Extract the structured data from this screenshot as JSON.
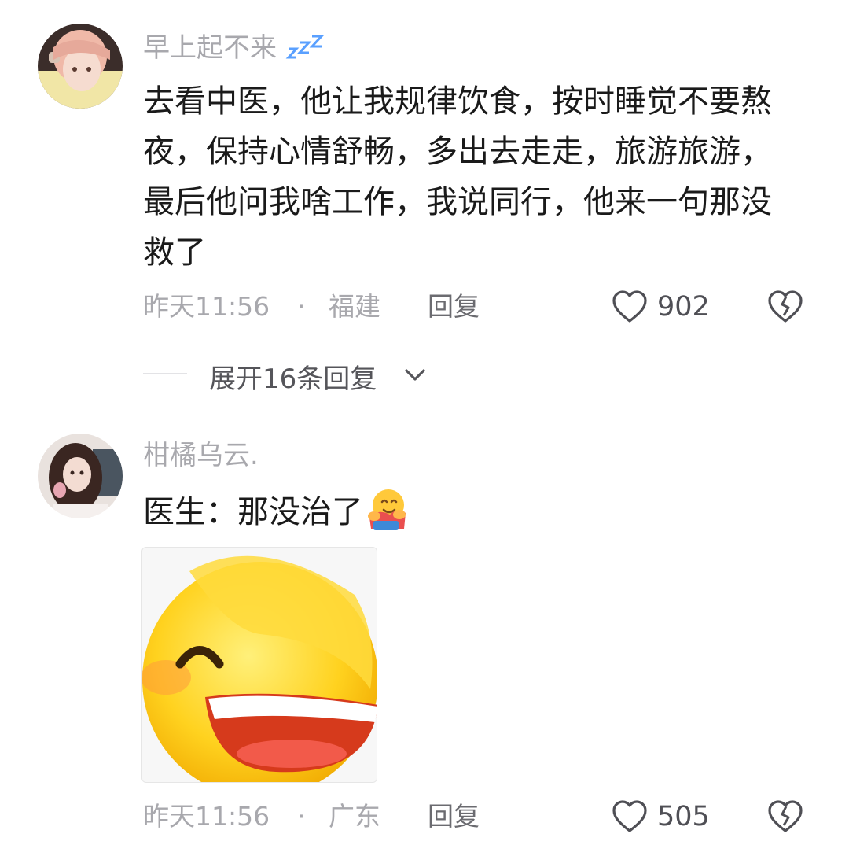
{
  "comments": [
    {
      "username": "早上起不来",
      "username_emoji": "zzz-icon",
      "text": "去看中医，他让我规律饮食，按时睡觉不要熬夜，保持心情舒畅，多出去走走，旅游旅游，最后他问我啥工作，我说同行，他来一句那没救了",
      "time": "昨天11:56",
      "separator": "·",
      "location": "福建",
      "reply_label": "回复",
      "likes": "902"
    },
    {
      "username": "柑橘乌云.",
      "text": "医生：那没治了",
      "text_emoji": "hugging-face-icon",
      "sticker": "facepalm-laughing-emoji",
      "time": "昨天11:56",
      "separator": "·",
      "location": "广东",
      "reply_label": "回复",
      "likes": "505"
    }
  ],
  "expand_replies": {
    "label": "展开16条回复"
  },
  "colors": {
    "meta_gray": "#a8a8ad",
    "text": "#1a1a1a",
    "accent_zzz": "#5aa0ff"
  }
}
